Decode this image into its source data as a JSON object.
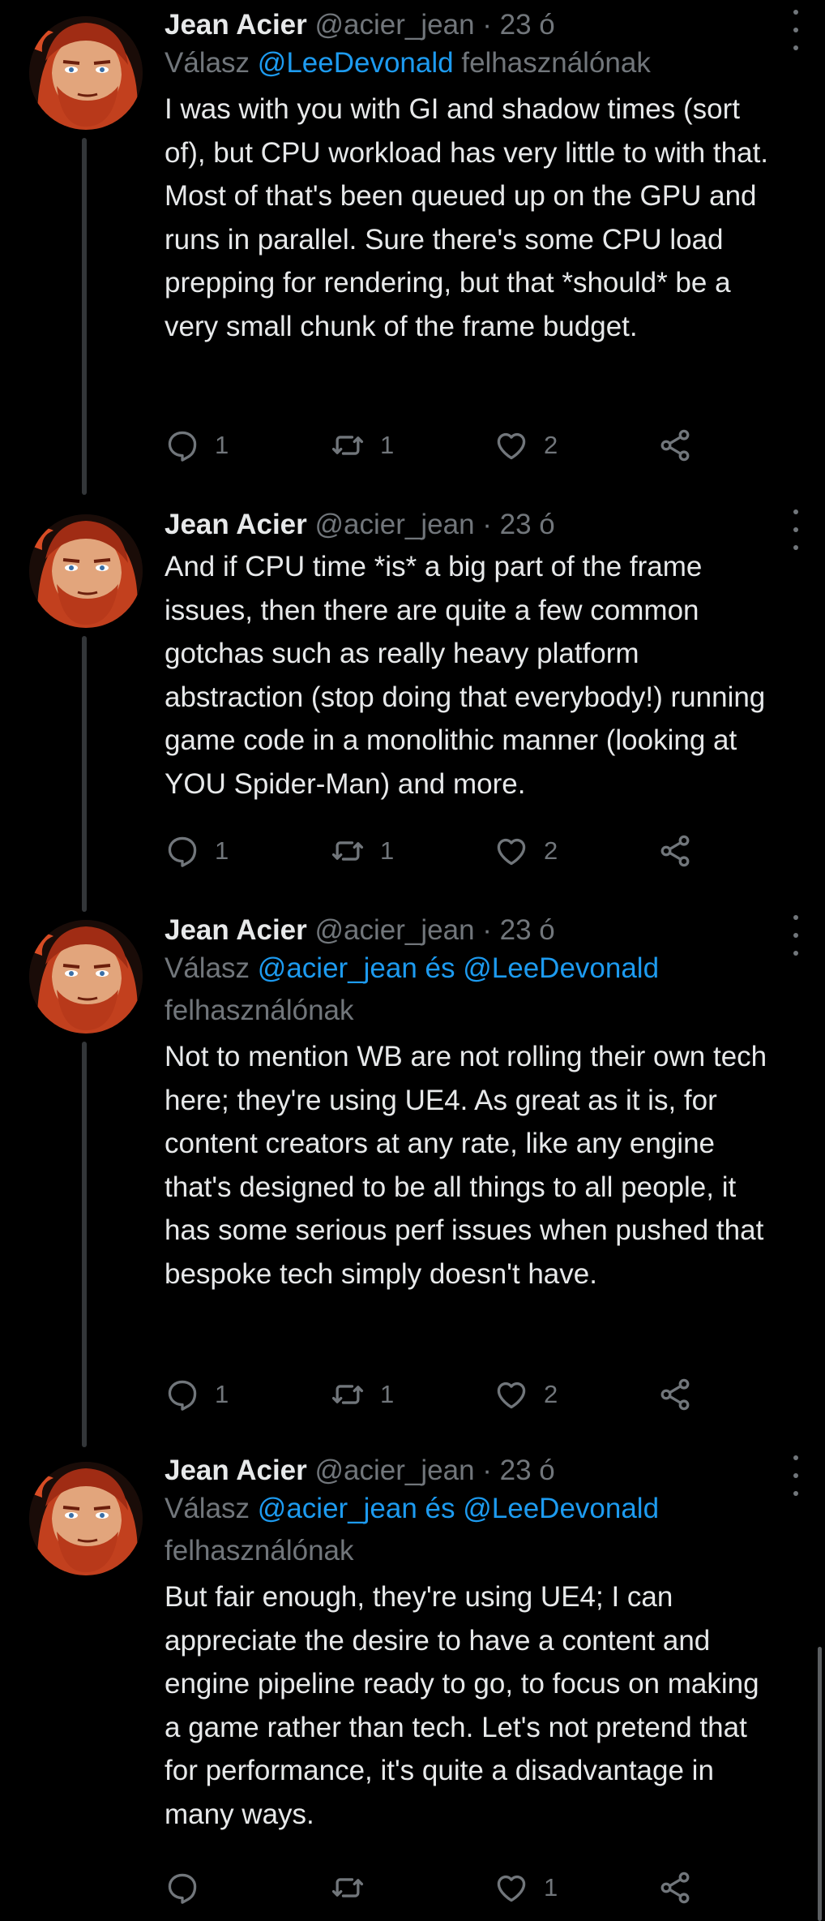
{
  "tweets": [
    {
      "name": "Jean Acier",
      "handle": "@acier_jean",
      "dot": "·",
      "time": "23 ó",
      "reply_prefix": "Válasz",
      "reply_mentions": "@LeeDevonald",
      "reply_suffix": "felhasználónak",
      "text": "I was with you with GI and shadow times (sort of), but  CPU workload has very little to with that. Most of that's been queued up on the GPU and runs in parallel. Sure there's some CPU load prepping for rendering, but that *should* be a very small chunk of the frame budget.",
      "replies": "1",
      "retweets": "1",
      "likes": "2"
    },
    {
      "name": "Jean Acier",
      "handle": "@acier_jean",
      "dot": "·",
      "time": "23 ó",
      "text": "And if CPU time *is* a big part of the frame issues, then there are quite a few common gotchas such as really heavy platform abstraction (stop doing that everybody!) running game code in a monolithic manner (looking at YOU Spider-Man) and more.",
      "replies": "1",
      "retweets": "1",
      "likes": "2"
    },
    {
      "name": "Jean Acier",
      "handle": "@acier_jean",
      "dot": "·",
      "time": "23 ó",
      "reply_prefix": "Válasz",
      "reply_mentions": "@acier_jean és @LeeDevonald",
      "reply_suffix": "felhasználónak",
      "text": "Not to mention WB are not rolling their own tech here; they're using UE4. As great as it is, for content creators at any rate, like any engine that's designed to be all things to all people, it has some serious perf issues when pushed that bespoke tech simply doesn't have.",
      "replies": "1",
      "retweets": "1",
      "likes": "2"
    },
    {
      "name": "Jean Acier",
      "handle": "@acier_jean",
      "dot": "·",
      "time": "23 ó",
      "reply_prefix": "Válasz",
      "reply_mentions": "@acier_jean és @LeeDevonald",
      "reply_suffix": "felhasználónak",
      "text": "But fair enough, they're using UE4; I can appreciate the desire to have a content and engine pipeline ready to go, to focus on making a game rather than tech. Let's not pretend that for performance, it's quite a disadvantage in many ways.",
      "replies": "",
      "retweets": "",
      "likes": "1"
    }
  ],
  "icons": [
    "reply-icon",
    "retweet-icon",
    "like-icon",
    "share-icon",
    "more-icon"
  ],
  "colors": {
    "background": "#000000",
    "text": "#e7e9ea",
    "muted": "#71767b",
    "link": "#1d9bf0"
  }
}
